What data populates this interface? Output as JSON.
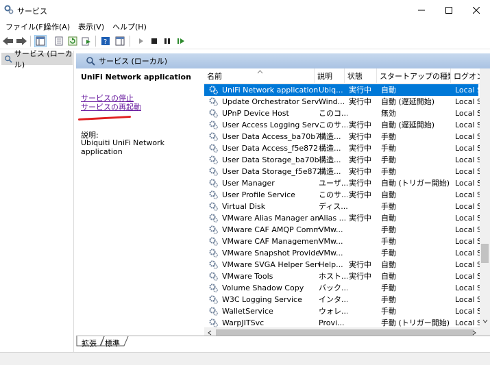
{
  "window": {
    "title": "サービス"
  },
  "menu": [
    "ファイル(F)",
    "操作(A)",
    "表示(V)",
    "ヘルプ(H)"
  ],
  "tree": {
    "root": "サービス (ローカル)"
  },
  "panel": {
    "header": "サービス (ローカル)"
  },
  "details": {
    "service_name": "UniFi Network application",
    "stop_link": "サービスの停止",
    "restart_link": "サービスの再起動",
    "desc_label": "説明:",
    "desc_text": "Ubiquiti UniFi Network application"
  },
  "columns": [
    "名前",
    "説明",
    "状態",
    "スタートアップの種類",
    "ログオン"
  ],
  "rows": [
    {
      "name": "UniFi Network application",
      "desc": "Ubiq...",
      "status": "実行中",
      "startup": "自動",
      "logon": "Local S"
    },
    {
      "name": "Update Orchestrator Service",
      "desc": "Wind...",
      "status": "実行中",
      "startup": "自動 (遅延開始)",
      "logon": "Local S"
    },
    {
      "name": "UPnP Device Host",
      "desc": "このコ...",
      "status": "",
      "startup": "無効",
      "logon": "Local S"
    },
    {
      "name": "User Access Logging Service",
      "desc": "このサ...",
      "status": "実行中",
      "startup": "自動 (遅延開始)",
      "logon": "Local S"
    },
    {
      "name": "User Data Access_ba70b7",
      "desc": "構造...",
      "status": "実行中",
      "startup": "手動",
      "logon": "Local S"
    },
    {
      "name": "User Data Access_f5e872",
      "desc": "構造...",
      "status": "実行中",
      "startup": "手動",
      "logon": "Local S"
    },
    {
      "name": "User Data Storage_ba70b7",
      "desc": "構造...",
      "status": "実行中",
      "startup": "手動",
      "logon": "Local S"
    },
    {
      "name": "User Data Storage_f5e872",
      "desc": "構造...",
      "status": "実行中",
      "startup": "手動",
      "logon": "Local S"
    },
    {
      "name": "User Manager",
      "desc": "ユーザ...",
      "status": "実行中",
      "startup": "自動 (トリガー開始)",
      "logon": "Local S"
    },
    {
      "name": "User Profile Service",
      "desc": "このサ...",
      "status": "実行中",
      "startup": "自動",
      "logon": "Local S"
    },
    {
      "name": "Virtual Disk",
      "desc": "ディス...",
      "status": "",
      "startup": "手動",
      "logon": "Local S"
    },
    {
      "name": "VMware Alias Manager and ...",
      "desc": "Alias ...",
      "status": "実行中",
      "startup": "自動",
      "logon": "Local S"
    },
    {
      "name": "VMware CAF AMQP Comm...",
      "desc": "VMw...",
      "status": "",
      "startup": "手動",
      "logon": "Local S"
    },
    {
      "name": "VMware CAF Management ...",
      "desc": "VMw...",
      "status": "",
      "startup": "手動",
      "logon": "Local S"
    },
    {
      "name": "VMware Snapshot Provider",
      "desc": "VMw...",
      "status": "",
      "startup": "手動",
      "logon": "Local S"
    },
    {
      "name": "VMware SVGA Helper Service",
      "desc": "Help...",
      "status": "実行中",
      "startup": "自動",
      "logon": "Local S"
    },
    {
      "name": "VMware Tools",
      "desc": "ホスト...",
      "status": "実行中",
      "startup": "自動",
      "logon": "Local S"
    },
    {
      "name": "Volume Shadow Copy",
      "desc": "バック...",
      "status": "",
      "startup": "手動",
      "logon": "Local S"
    },
    {
      "name": "W3C Logging Service",
      "desc": "インタ...",
      "status": "",
      "startup": "手動",
      "logon": "Local S"
    },
    {
      "name": "WalletService",
      "desc": "ウォレ...",
      "status": "",
      "startup": "手動",
      "logon": "Local S"
    },
    {
      "name": "WarpJITSvc",
      "desc": "Provi...",
      "status": "",
      "startup": "手動 (トリガー開始)",
      "logon": "Local S"
    }
  ],
  "tabs": {
    "extended": "拡張",
    "standard": "標準"
  },
  "colors": {
    "selection": "#0078d7",
    "panel_header": "#b8cfe9",
    "link": "#6b1fa0",
    "annotation": "#e02020"
  }
}
